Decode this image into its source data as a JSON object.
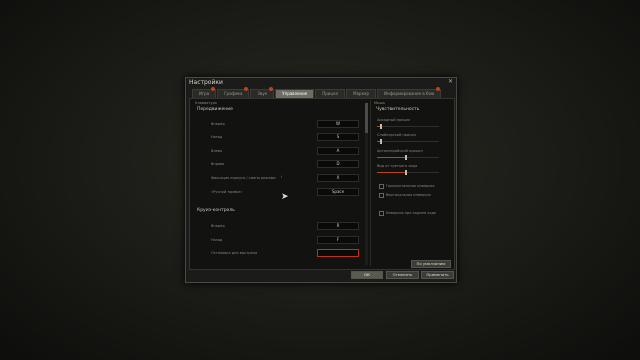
{
  "window": {
    "title": "Настройки",
    "close": "✕"
  },
  "tabs": [
    {
      "label": "Игра",
      "badge": true
    },
    {
      "label": "Графика",
      "badge": true
    },
    {
      "label": "Звук",
      "badge": true
    },
    {
      "label": "Управление",
      "badge": false,
      "active": true
    },
    {
      "label": "Прицел",
      "badge": false
    },
    {
      "label": "Маркер",
      "badge": false
    },
    {
      "label": "Информирование в бою",
      "badge": true
    }
  ],
  "left": {
    "group_label": "Клавиатура",
    "section1": "Передвижение",
    "rows1": [
      {
        "label": "Вперёд",
        "key": "W"
      },
      {
        "label": "Назад",
        "key": "S"
      },
      {
        "label": "Влево",
        "key": "A"
      },
      {
        "label": "Вправо",
        "key": "D"
      },
      {
        "label": "Фиксация корпуса / смена режима",
        "key": "X",
        "info": "i"
      },
      {
        "label": "«Ручной тормоз»",
        "key": "Space"
      }
    ],
    "section2": "Круиз-контроль",
    "rows2": [
      {
        "label": "Вперёд",
        "key": "R"
      },
      {
        "label": "Назад",
        "key": "F"
      },
      {
        "label": "Остановка для выстрела",
        "key": ""
      }
    ]
  },
  "right": {
    "group_label": "Мышь",
    "section": "Чувствительность",
    "sliders": [
      {
        "label": "Аркадный прицел",
        "value": 0.05
      },
      {
        "label": "Снайперский прицел",
        "value": 0.05
      },
      {
        "label": "Артиллерийский прицел",
        "value": 0.45
      },
      {
        "label": "Вид от третьего лица",
        "value": 0.45
      }
    ],
    "checkboxes": [
      {
        "label": "Горизонтальная инверсия",
        "checked": false
      },
      {
        "label": "Вертикальная инверсия",
        "checked": false
      },
      {
        "label": "Инверсия при заднем ходе",
        "checked": false
      }
    ],
    "default_button": "По умолчанию"
  },
  "footer": {
    "ok": "ОК",
    "cancel": "Отменить",
    "apply": "Применить"
  },
  "colors": {
    "accent": "#b4451c",
    "active_key_border": "#c0301c"
  }
}
